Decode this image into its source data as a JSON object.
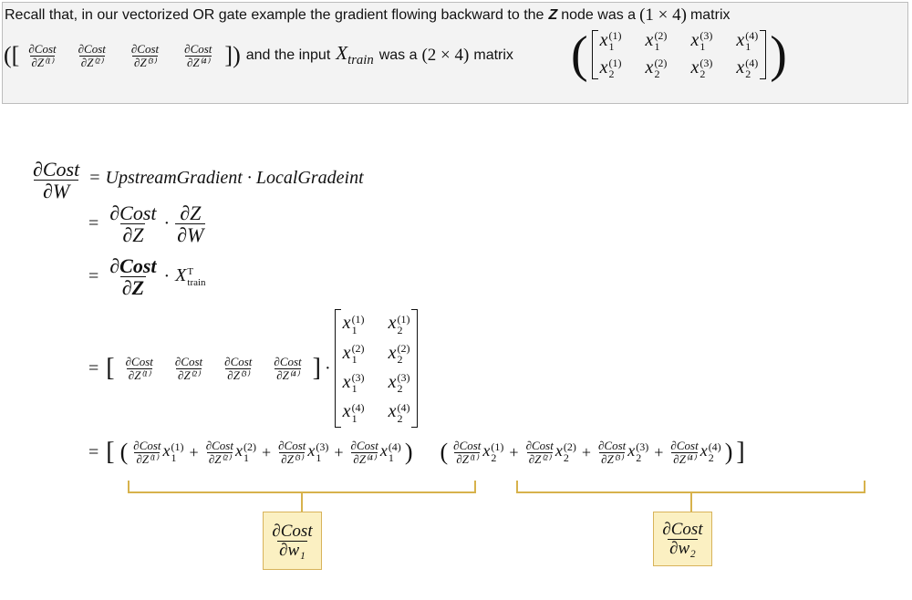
{
  "note": {
    "line1_a": "Recall that, in our vectorized OR gate example the gradient flowing backward to the",
    "line1_z": "Z",
    "line1_b": "node was a",
    "line1_dim": "(1 × 4)",
    "line1_c": "matrix",
    "line2_a": "and the input",
    "line2_var": "X",
    "line2_sub": "train",
    "line2_b": "was a",
    "line2_dim": "(2 × 4)",
    "line2_c": "matrix",
    "grad_num": "∂Cost",
    "grad_den": [
      "∂Z⁽¹⁾",
      "∂Z⁽²⁾",
      "∂Z⁽³⁾",
      "∂Z⁽⁴⁾"
    ]
  },
  "derivation": {
    "lhs_num": "∂Cost",
    "lhs_den": "∂W",
    "line1": "= UpstreamGradient · LocalGradeint",
    "line2_num1": "∂Cost",
    "line2_den1": "∂Z",
    "line2_num2": "∂Z",
    "line2_den2": "∂W",
    "line3_num": "∂Cost",
    "line3_den": "∂Z",
    "line3_x": "X",
    "line3_sup": "T",
    "line3_sub": "train",
    "eq": "="
  },
  "annotations": {
    "w1_num": "∂Cost",
    "w1_den": "∂w₁",
    "w2_num": "∂Cost",
    "w2_den": "∂w₂"
  },
  "colors": {
    "note_bg": "#f3f3f3",
    "box_bg": "#fbf0c2",
    "box_border": "#d8b35a"
  }
}
